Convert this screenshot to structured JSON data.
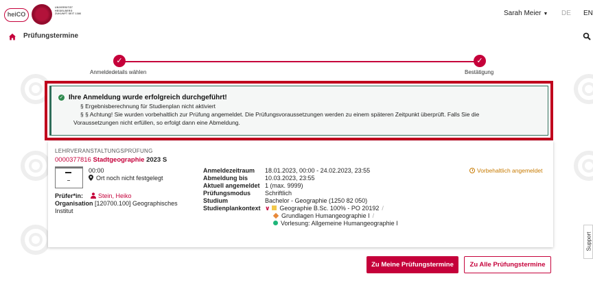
{
  "header": {
    "logo_text": "heiCO",
    "uni_text": "UNIVERSITÄT HEIDELBERG ZUKUNFT SEIT 1386",
    "user_name": "Sarah Meier",
    "lang_de": "DE",
    "lang_en": "EN"
  },
  "subnav": {
    "title": "Prüfungstermine"
  },
  "stepper": {
    "step1_label": "Anmeldedetails wählen",
    "step2_label": "Bestätigung"
  },
  "success": {
    "title": "Ihre Anmeldung wurde erfolgreich durchgeführt!",
    "line1": "§ Ergebnisberechnung für Studienplan nicht aktiviert",
    "line2": "§ § Achtung! Sie wurden vorbehaltlich zur Prüfung angemeldet. Die Prüfungsvoraussetzungen werden zu einem späteren Zeitpunkt überprüft. Falls Sie die",
    "line3": "Voraussetzungen nicht erfüllen, so erfolgt dann eine Abmeldung."
  },
  "exam": {
    "type": "LEHRVERANSTALTUNGSPRÜFUNG",
    "number": "0000377816",
    "name": "Stadtgeographie",
    "semester": "2023 S",
    "time": "00:00",
    "location": "Ort noch nicht festgelegt",
    "examiner_label": "Prüfer*in:",
    "examiner": "Stein, Heiko",
    "org_label": "Organisation",
    "org_value": "[120700.100] Geographisches Institut",
    "status": "Vorbehaltlich angemeldet",
    "details": [
      {
        "label": "Anmeldezeitraum",
        "value": "18.01.2023, 00:00 - 24.02.2023, 23:55"
      },
      {
        "label": "Abmeldung bis",
        "value": "10.03.2023, 23:55"
      },
      {
        "label": "Aktuell angemeldet",
        "value": "1 (max. 9999)"
      },
      {
        "label": "Prüfungsmodus",
        "value": "Schriftlich"
      },
      {
        "label": "Studium",
        "value": "Bachelor - Geographie (1250 82 050)"
      },
      {
        "label": "Studienplankontext",
        "value": ""
      }
    ],
    "context": [
      {
        "text": "Geographie B.Sc. 100% - PO 20192",
        "icon": "yellow-square"
      },
      {
        "text": "Grundlagen Humangeographie I",
        "icon": "orange-diamond"
      },
      {
        "text": "Vorlesung: Allgemeine Humangeographie I",
        "icon": "green-dot"
      }
    ],
    "context_separator": "/"
  },
  "buttons": {
    "primary": "Zu Meine Prüfungstermine",
    "secondary": "Zu Alle Prüfungstermine"
  },
  "support": "Support",
  "colors": {
    "brand": "#c5003a",
    "success": "#2f8a4e",
    "warning": "#c77a00"
  }
}
